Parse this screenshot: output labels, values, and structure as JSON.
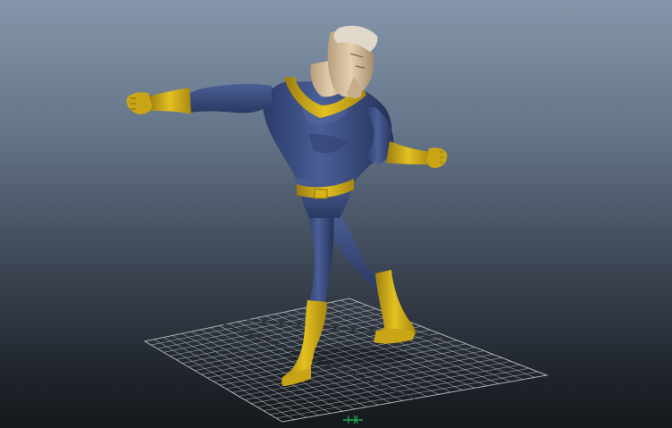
{
  "viewport": {
    "type": "3d-perspective-viewport",
    "background_top_color": "#8596ab",
    "background_bottom_color": "#15181c",
    "grid": {
      "visible": true,
      "line_color": "#aeb3b8",
      "axis_color": "#2a2d31"
    },
    "axis_gizmo": {
      "visible": true,
      "color": "#1faa55"
    },
    "model": {
      "name": "superhero-character",
      "pose": "arms-outstretched-walking",
      "colors": {
        "suit": "#3a4f86",
        "suit_shadow": "#24325a",
        "trim": "#d7b41a",
        "trim_shadow": "#8f7410",
        "skin": "#d9c3a3",
        "hair": "#e0d8c8"
      }
    }
  }
}
